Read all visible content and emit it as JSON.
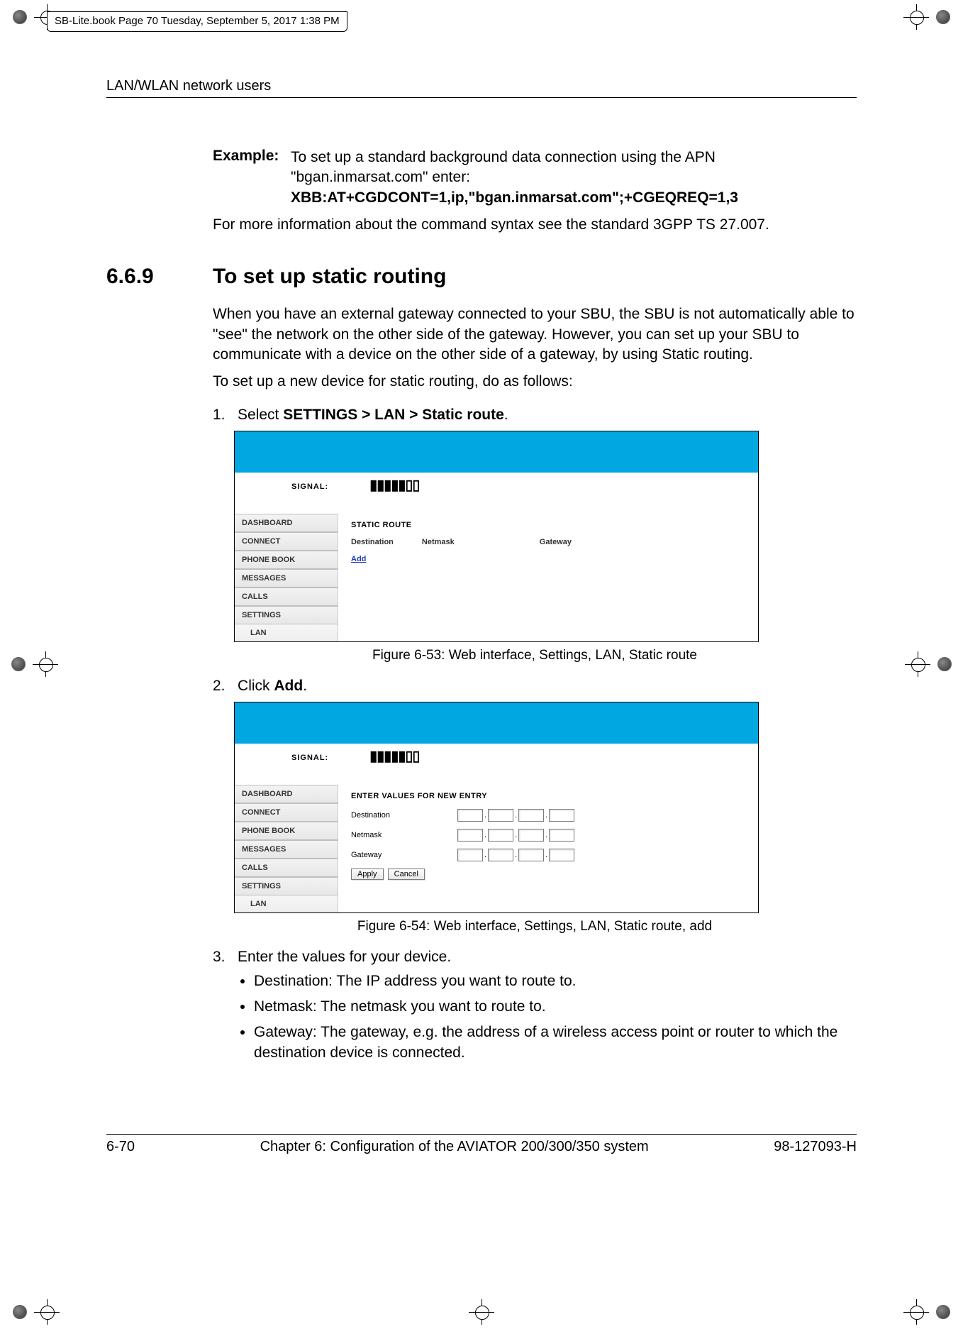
{
  "meta": {
    "text": "SB-Lite.book  Page 70  Tuesday, September 5, 2017  1:38 PM"
  },
  "header": {
    "running": "LAN/WLAN network users"
  },
  "example": {
    "label": "Example:",
    "line1": "To set up a standard background data connection using the APN \"bgan.inmarsat.com\" enter:",
    "line2": "XBB:AT+CGDCONT=1,ip,\"bgan.inmarsat.com\";+CGEQREQ=1,3"
  },
  "para1": "For more information about the command syntax see the standard 3GPP TS 27.007.",
  "section": {
    "num": "6.6.9",
    "title": "To set up static routing"
  },
  "para2": "When you have an external gateway connected to your SBU, the SBU is not automatically able to \"see\" the network on the other side of the gateway. However, you can set up your SBU to communicate with a device on the other side of a gateway, by using Static routing.",
  "para3": "To set up a new device for static routing, do as follows:",
  "step1": {
    "num": "1.",
    "pre": "Select ",
    "bold": "SETTINGS > LAN > Static route",
    "post": "."
  },
  "mock1": {
    "signal_label": "SIGNAL:",
    "signal_bars": "▮▮▮▮▮▯▯",
    "sidebar": {
      "items": [
        "DASHBOARD",
        "CONNECT",
        "PHONE BOOK",
        "MESSAGES",
        "CALLS",
        "SETTINGS",
        "LAN"
      ]
    },
    "heading": "STATIC ROUTE",
    "cols": {
      "dest": "Destination",
      "mask": "Netmask",
      "gw": "Gateway"
    },
    "add": "Add"
  },
  "caption1": "Figure 6-53: Web interface, Settings, LAN, Static route",
  "step2": {
    "num": "2.",
    "pre": "Click ",
    "bold": "Add",
    "post": "."
  },
  "mock2": {
    "signal_label": "SIGNAL:",
    "signal_bars": "▮▮▮▮▮▯▯",
    "sidebar": {
      "items": [
        "DASHBOARD",
        "CONNECT",
        "PHONE BOOK",
        "MESSAGES",
        "CALLS",
        "SETTINGS",
        "LAN"
      ]
    },
    "heading": "ENTER VALUES FOR NEW ENTRY",
    "labels": {
      "dest": "Destination",
      "mask": "Netmask",
      "gw": "Gateway"
    },
    "buttons": {
      "apply": "Apply",
      "cancel": "Cancel"
    }
  },
  "caption2": "Figure 6-54: Web interface, Settings, LAN, Static route, add",
  "step3": {
    "num": "3.",
    "line": "Enter the values for your device.",
    "b1": "Destination: The IP address you want to route to.",
    "b2": "Netmask: The netmask you want to route to.",
    "b3": "Gateway: The gateway, e.g. the address of a wireless access point or router to which the destination device is connected."
  },
  "footer": {
    "left": "6-70",
    "center": "Chapter 6:  Configuration of the AVIATOR 200/300/350 system",
    "right": "98-127093-H"
  }
}
